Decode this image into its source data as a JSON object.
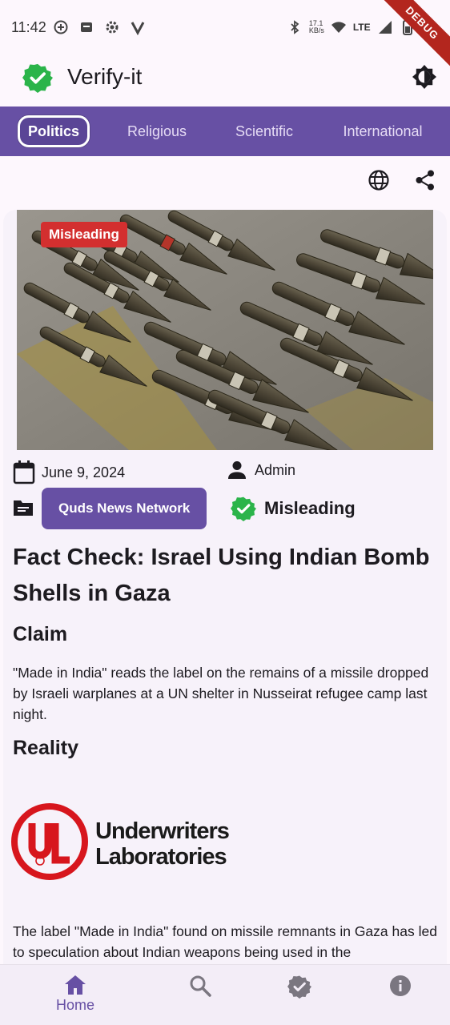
{
  "status_bar": {
    "time": "11:42",
    "net_speed": "17.1\nKB/s",
    "network": "LTE",
    "battery": "47",
    "debug": "DEBUG"
  },
  "app": {
    "title": "Verify-it",
    "accent": "#6750a4",
    "verified_color": "#2bb44a"
  },
  "tabs": [
    {
      "label": "Politics",
      "active": true
    },
    {
      "label": "Religious",
      "active": false
    },
    {
      "label": "Scientific",
      "active": false
    },
    {
      "label": "International",
      "active": false
    }
  ],
  "article": {
    "image_badge": "Misleading",
    "date": "June 9, 2024",
    "author": "Admin",
    "source": "Quds News Network",
    "verdict": "Misleading",
    "headline": "Fact Check: Israel Using Indian Bomb Shells in Gaza",
    "claim_heading": "Claim",
    "claim_text": "\"Made in India\" reads the label on the remains of a missile dropped by Israeli warplanes at a UN shelter in Nusseirat refugee camp last night.",
    "reality_heading": "Reality",
    "logo_text": "Underwriters Laboratories",
    "reality_text": "The label \"Made in India\" found on missile remnants in Gaza has led to speculation about Indian weapons being used in the"
  },
  "bottom_nav": [
    {
      "label": "Home",
      "icon": "home-icon",
      "active": true
    },
    {
      "label": "",
      "icon": "search-icon",
      "active": false
    },
    {
      "label": "",
      "icon": "verified-icon",
      "active": false
    },
    {
      "label": "",
      "icon": "info-icon",
      "active": false
    }
  ]
}
